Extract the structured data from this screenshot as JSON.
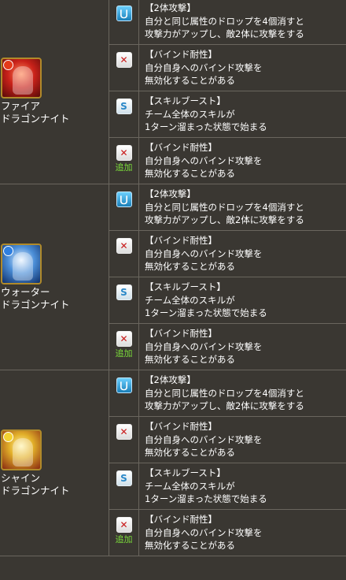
{
  "groups": [
    {
      "monster": {
        "name_line1": "ファイア",
        "name_line2": "ドラゴンナイト",
        "icon": "fire-dragon-knight-portrait",
        "color": "#c9221a"
      },
      "awakenings": [
        {
          "icon": "two-way-attack-icon",
          "title": "【2体攻撃】",
          "lines": [
            "自分と同じ属性のドロップを4個消すと",
            "攻撃力がアップし、敵2体に攻撃をする"
          ],
          "added": ""
        },
        {
          "icon": "bind-resist-icon",
          "title": "【バインド耐性】",
          "lines": [
            "自分自身へのバインド攻撃を",
            "無効化することがある"
          ],
          "added": ""
        },
        {
          "icon": "skill-boost-icon",
          "title": "【スキルブースト】",
          "lines": [
            "チーム全体のスキルが",
            "1ターン溜まった状態で始まる"
          ],
          "added": ""
        },
        {
          "icon": "bind-resist-icon",
          "title": "【バインド耐性】",
          "lines": [
            "自分自身へのバインド攻撃を",
            "無効化することがある"
          ],
          "added": "追加"
        }
      ]
    },
    {
      "monster": {
        "name_line1": "ウォーター",
        "name_line2": "ドラゴンナイト",
        "icon": "water-dragon-knight-portrait",
        "color": "#2f7fe0"
      },
      "awakenings": [
        {
          "icon": "two-way-attack-icon",
          "title": "【2体攻撃】",
          "lines": [
            "自分と同じ属性のドロップを4個消すと",
            "攻撃力がアップし、敵2体に攻撃をする"
          ],
          "added": ""
        },
        {
          "icon": "bind-resist-icon",
          "title": "【バインド耐性】",
          "lines": [
            "自分自身へのバインド攻撃を",
            "無効化することがある"
          ],
          "added": ""
        },
        {
          "icon": "skill-boost-icon",
          "title": "【スキルブースト】",
          "lines": [
            "チーム全体のスキルが",
            "1ターン溜まった状態で始まる"
          ],
          "added": ""
        },
        {
          "icon": "bind-resist-icon",
          "title": "【バインド耐性】",
          "lines": [
            "自分自身へのバインド攻撃を",
            "無効化することがある"
          ],
          "added": "追加"
        }
      ]
    },
    {
      "monster": {
        "name_line1": "シャイン",
        "name_line2": "ドラゴンナイト",
        "icon": "light-dragon-knight-portrait",
        "color": "#f3d230"
      },
      "awakenings": [
        {
          "icon": "two-way-attack-icon",
          "title": "【2体攻撃】",
          "lines": [
            "自分と同じ属性のドロップを4個消すと",
            "攻撃力がアップし、敵2体に攻撃をする"
          ],
          "added": ""
        },
        {
          "icon": "bind-resist-icon",
          "title": "【バインド耐性】",
          "lines": [
            "自分自身へのバインド攻撃を",
            "無効化することがある"
          ],
          "added": ""
        },
        {
          "icon": "skill-boost-icon",
          "title": "【スキルブースト】",
          "lines": [
            "チーム全体のスキルが",
            "1ターン溜まった状態で始まる"
          ],
          "added": ""
        },
        {
          "icon": "bind-resist-icon",
          "title": "【バインド耐性】",
          "lines": [
            "自分自身へのバインド攻撃を",
            "無効化することがある"
          ],
          "added": "追加"
        }
      ]
    }
  ]
}
